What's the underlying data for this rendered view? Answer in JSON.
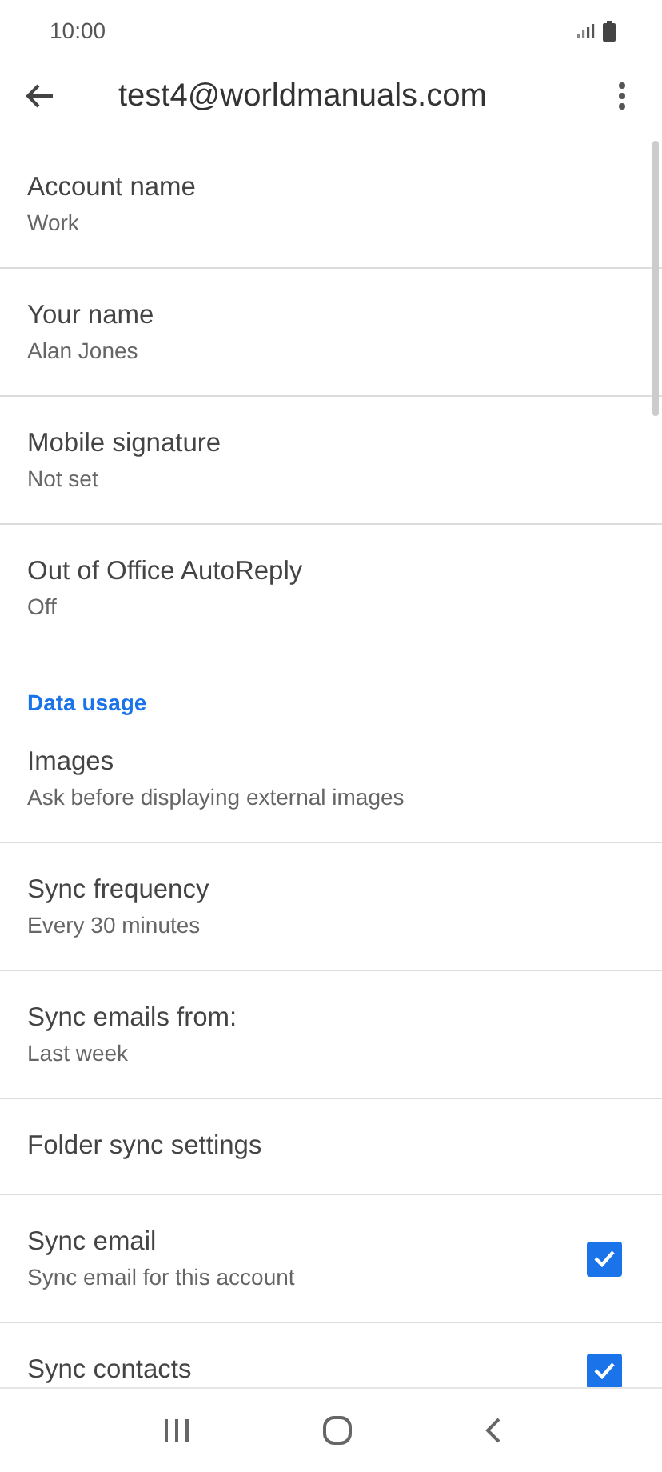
{
  "status_bar": {
    "time": "10:00"
  },
  "app_bar": {
    "title": "test4@worldmanuals.com"
  },
  "settings": [
    {
      "kind": "setting",
      "title": "Account name",
      "subtitle": "Work"
    },
    {
      "kind": "setting",
      "title": "Your name",
      "subtitle": "Alan Jones"
    },
    {
      "kind": "setting",
      "title": "Mobile signature",
      "subtitle": "Not set"
    },
    {
      "kind": "setting",
      "title": "Out of Office AutoReply",
      "subtitle": "Off"
    },
    {
      "kind": "header",
      "title": "Data usage"
    },
    {
      "kind": "setting",
      "title": "Images",
      "subtitle": "Ask before displaying external images"
    },
    {
      "kind": "setting",
      "title": "Sync frequency",
      "subtitle": "Every 30 minutes"
    },
    {
      "kind": "setting",
      "title": "Sync emails from:",
      "subtitle": "Last week"
    },
    {
      "kind": "setting",
      "title": "Folder sync settings"
    },
    {
      "kind": "checkbox",
      "title": "Sync email",
      "subtitle": "Sync email for this account",
      "checked": true
    },
    {
      "kind": "checkbox",
      "title": "Sync contacts",
      "checked": true
    }
  ]
}
